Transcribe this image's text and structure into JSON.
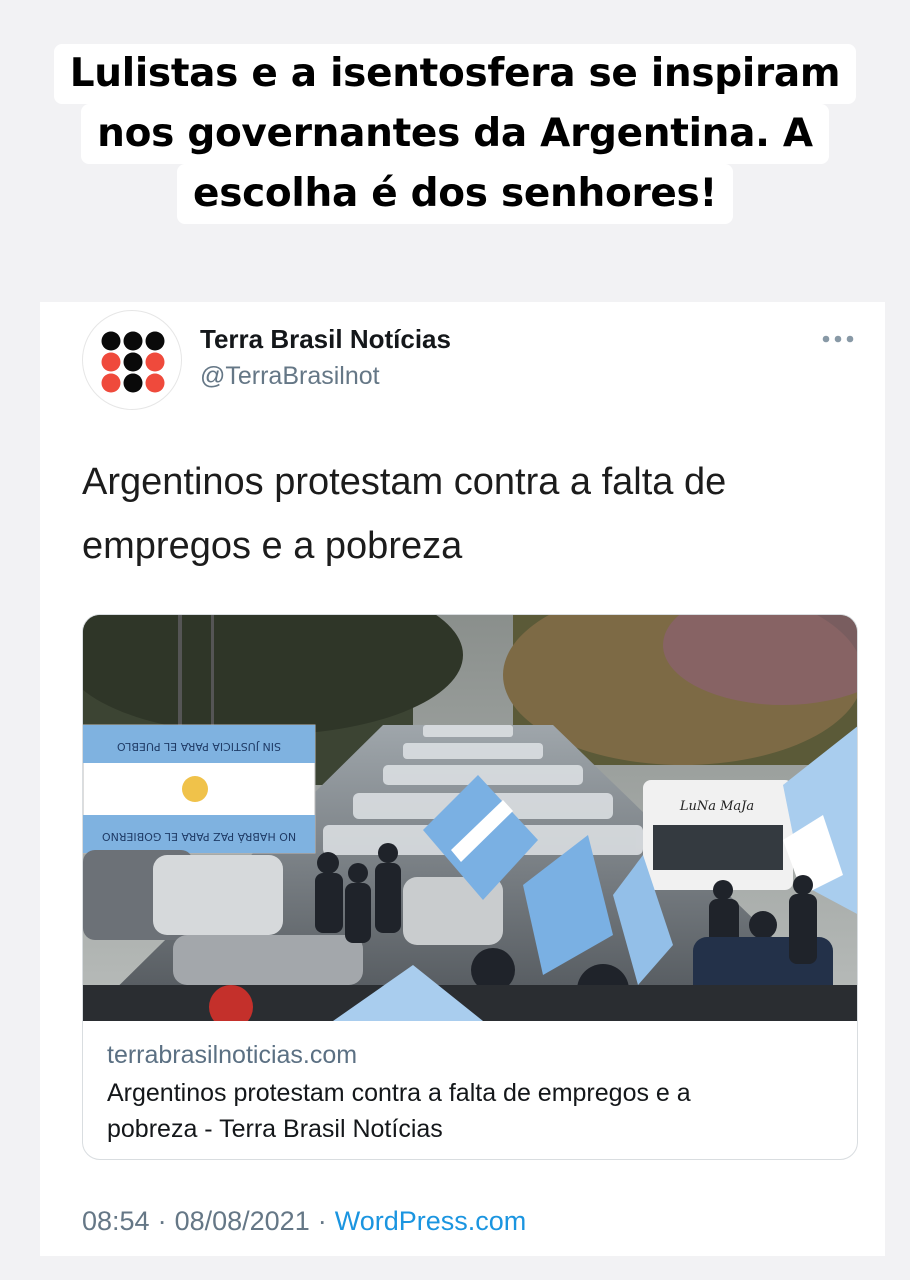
{
  "caption": {
    "lines": [
      "Lulistas e a isentosfera se inspiram",
      "nos governantes da Argentina. A",
      "escolha é dos senhores!"
    ]
  },
  "tweet": {
    "author_name": "Terra Brasil Notícias",
    "author_handle": "@TerraBrasilnot",
    "text_lines": [
      "Argentinos protestam contra a falta de",
      "empregos e a pobreza"
    ],
    "more_icon": "more-horizontal-icon",
    "link_card": {
      "domain": "terrabrasilnoticias.com",
      "title_lines": [
        "Argentinos protestam contra a falta de empregos e a",
        "pobreza - Terra Brasil Notícias"
      ],
      "image_banner_top": "SIN JUSTICIA PARA EL PUEBLO",
      "image_banner_bottom": "NO HABRÁ PAZ PARA EL GOBIERNO",
      "image_truck_text": "LuNa MaJa"
    },
    "time": "08:54",
    "date": "08/08/2021",
    "separator": "·",
    "source": "WordPress.com"
  },
  "colors": {
    "background": "#f2f2f4",
    "link_blue": "#1b95e0",
    "muted": "#657786",
    "logo_red": "#ef4a3c",
    "logo_black": "#0a0a0a",
    "flag_blue": "#74acdf"
  }
}
